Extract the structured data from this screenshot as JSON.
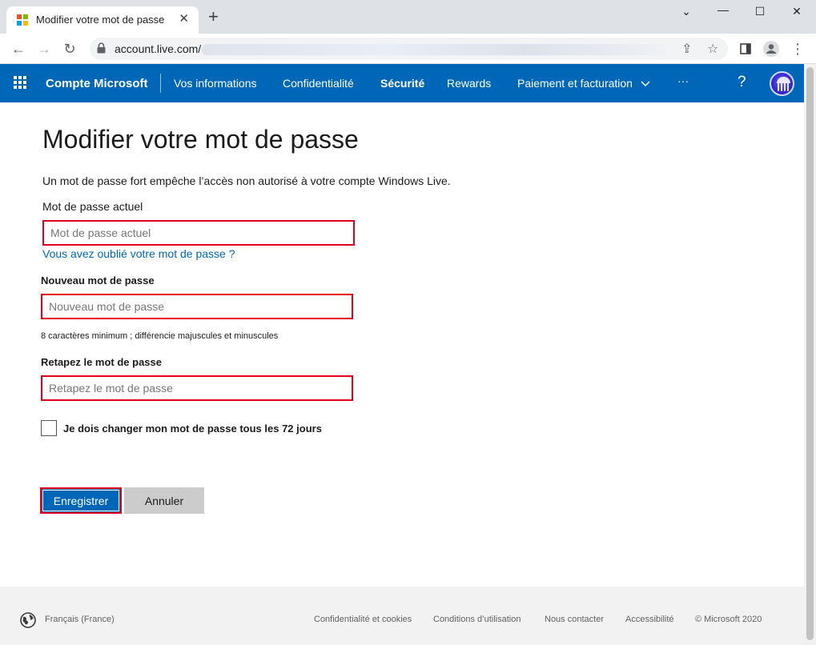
{
  "browser": {
    "tab_title": "Modifier votre mot de passe",
    "url": "account.live.com/",
    "window": {
      "minimize": "—",
      "maximize": "☐",
      "close": "✕",
      "collapse": "⌄"
    }
  },
  "nav": {
    "brand": "Compte Microsoft",
    "items": [
      {
        "label": "Vos informations"
      },
      {
        "label": "Confidentialité"
      },
      {
        "label": "Sécurité",
        "active": true
      },
      {
        "label": "Rewards"
      },
      {
        "label": "Paiement et facturation"
      },
      {
        "label": "···"
      }
    ],
    "help": "?"
  },
  "page": {
    "title": "Modifier votre mot de passe",
    "intro": "Un mot de passe fort empêche l’accès non autorisé à votre compte Windows Live.",
    "current_label": "Mot de passe actuel",
    "current_placeholder": "Mot de passe actuel",
    "forgot_link": "Vous avez oublié votre mot de passe ?",
    "new_label": "Nouveau mot de passe",
    "new_placeholder": "Nouveau mot de passe",
    "hint": "8 caractères minimum ; différencie majuscules et minuscules",
    "retype_label": "Retapez le mot de passe",
    "retype_placeholder": "Retapez le mot de passe",
    "checkbox_label": "Je dois changer mon mot de passe tous les 72 jours",
    "checkbox_checked": false,
    "save_button": "Enregistrer",
    "cancel_button": "Annuler"
  },
  "footer": {
    "language": "Français (France)",
    "links": [
      {
        "label": "Confidentialité et cookies"
      },
      {
        "label": "Conditions d’utilisation"
      },
      {
        "label": "Nous contacter"
      },
      {
        "label": "Accessibilité"
      },
      {
        "label": "© Microsoft 2020"
      }
    ]
  },
  "colors": {
    "nav_bg": "#0067b8",
    "highlight_border": "#e3001b",
    "link": "#0067b8",
    "footer_bg": "#f2f2f2"
  }
}
